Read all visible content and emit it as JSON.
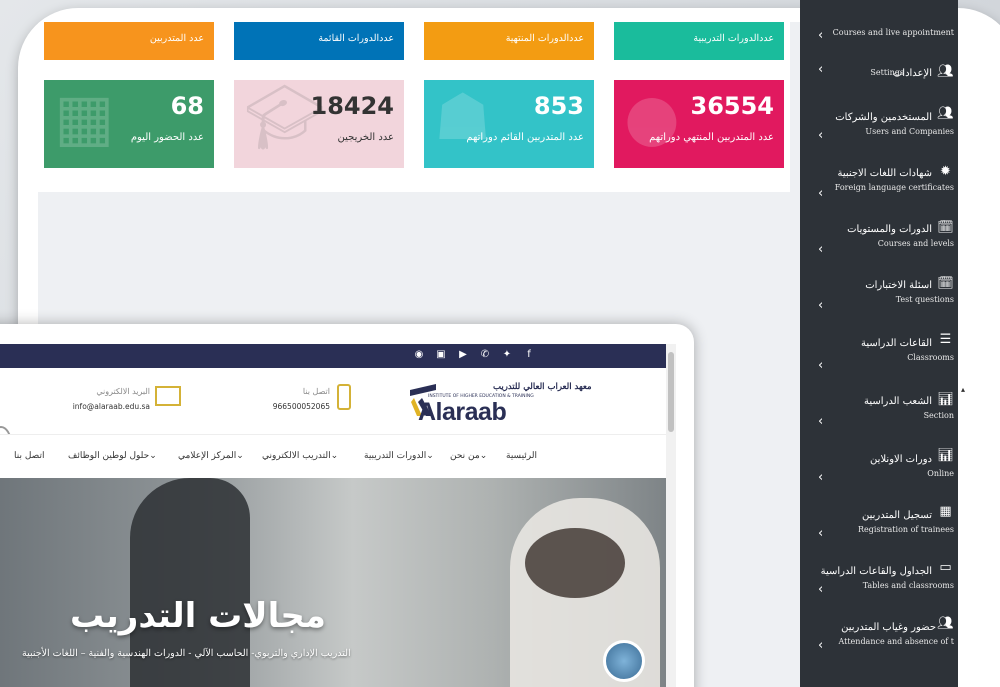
{
  "dashboard": {
    "top_strips": [
      {
        "label": "عدد المتدربين",
        "color": "#f7941d"
      },
      {
        "label": "عددالدورات القائمة",
        "color": "#0073b7"
      },
      {
        "label": "عددالدورات المنتهية",
        "color": "#f39c12"
      },
      {
        "label": "عددالدورات التدريبية",
        "color": "#1abc9c"
      }
    ],
    "stats": [
      {
        "value": "68",
        "label": "عدد الحضور اليوم",
        "color": "#3d9b6a",
        "icon": "calendar-check-icon"
      },
      {
        "value": "18424",
        "label": "عدد الخريجين",
        "color": "#f2d5dc",
        "icon": "graduation-cap-icon"
      },
      {
        "value": "853",
        "label": "عدد المتدربين القائم دوراتهم",
        "color": "#33c3c8",
        "icon": "person-icon"
      },
      {
        "value": "36554",
        "label": "عدد المتدربين المنتهي دوراتهم",
        "color": "#e1195f",
        "icon": "user-icon"
      }
    ]
  },
  "sidebar": {
    "items": [
      {
        "ar": "",
        "en": "Courses and live appointment",
        "icon": "people-icon"
      },
      {
        "ar": "الإعدادات",
        "en": "Settings",
        "icon": "people-icon"
      },
      {
        "ar": "المستخدمين والشركات",
        "en": "Users and Companies",
        "icon": "people-icon"
      },
      {
        "ar": "شهادات اللغات الاجنبية",
        "en": "Foreign language certificates",
        "icon": "certificate-icon"
      },
      {
        "ar": "الدورات والمستويات",
        "en": "Courses and levels",
        "icon": "calendar-icon"
      },
      {
        "ar": "اسئلة الاختبارات",
        "en": "Test questions",
        "icon": "calendar-icon"
      },
      {
        "ar": "القاعات الدراسية",
        "en": "Classrooms",
        "icon": "table-icon"
      },
      {
        "ar": "الشعب الدراسية",
        "en": "Section",
        "icon": "bar-chart-icon"
      },
      {
        "ar": "دورات الاونلاين",
        "en": "Online",
        "icon": "bar-chart-icon"
      },
      {
        "ar": "تسجيل المتدربين",
        "en": "Registration of trainees",
        "icon": "grid-calendar-icon"
      },
      {
        "ar": "الجداول والقاعات الدراسية",
        "en": "Tables and classrooms",
        "icon": "monitor-icon"
      },
      {
        "ar": "حضور وغياب المتدربين",
        "en": "Attendance and absence of t",
        "icon": "people-icon"
      }
    ]
  },
  "website": {
    "social_icons": [
      "instagram-icon",
      "camera-icon",
      "youtube-icon",
      "whatsapp-icon",
      "twitter-icon",
      "facebook-icon"
    ],
    "logo": {
      "ar": "معهد العراب العالي للتدريب",
      "sub": "INSTITUTE OF HIGHER EDUCATION & TRAINING",
      "en": "Alaraab"
    },
    "contact": {
      "phone_label": "اتصل بنا",
      "phone": "966500052065",
      "email_label": "البريد الالكتروني",
      "email": "info@alaraab.edu.sa"
    },
    "nav": [
      {
        "label": "الرئيسية"
      },
      {
        "label": "من نحن⌄"
      },
      {
        "label": "الدورات التدريبية⌄"
      },
      {
        "label": "التدريب الالكتروني⌄"
      },
      {
        "label": "المركز الإعلامي⌄"
      },
      {
        "label": "حلول لوطين الوظائف⌄"
      },
      {
        "label": "اتصل بنا"
      }
    ],
    "hero": {
      "title": "مجالات التدريب",
      "subtitle": "التدريب الإداري والتربوي- الحاسب الآلي - الدورات الهندسية والفنية – اللغات الأجنبية"
    }
  }
}
